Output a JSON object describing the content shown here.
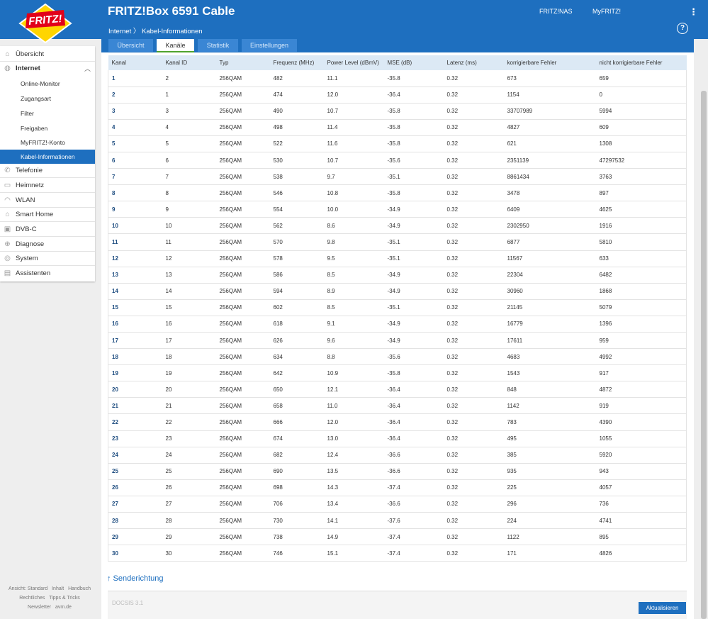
{
  "header": {
    "logo_text": "FRITZ!",
    "product": "FRITZ!Box 6591 Cable",
    "links": [
      "FRITZ!NAS",
      "MyFRITZ!"
    ],
    "menu_icon": "kebab-icon",
    "breadcrumb_parent": "Internet",
    "breadcrumb_sep": "〉",
    "breadcrumb_current": "Kabel-Informationen",
    "help": "?"
  },
  "tabs": [
    "Übersicht",
    "Kanäle",
    "Statistik",
    "Einstellungen"
  ],
  "sidebar": {
    "items": [
      {
        "label": "Übersicht",
        "icon": "home-icon"
      },
      {
        "label": "Internet",
        "icon": "globe-icon"
      },
      {
        "label": "Online-Monitor"
      },
      {
        "label": "Zugangsart"
      },
      {
        "label": "Filter"
      },
      {
        "label": "Freigaben"
      },
      {
        "label": "MyFRITZ!-Konto"
      },
      {
        "label": "Kabel-Informationen"
      },
      {
        "label": "Telefonie",
        "icon": "phone-icon"
      },
      {
        "label": "Heimnetz",
        "icon": "network-icon"
      },
      {
        "label": "WLAN",
        "icon": "wifi-icon"
      },
      {
        "label": "Smart Home",
        "icon": "smart-home-icon"
      },
      {
        "label": "DVB-C",
        "icon": "tv-icon"
      },
      {
        "label": "Diagnose",
        "icon": "diagnose-icon"
      },
      {
        "label": "System",
        "icon": "system-icon"
      },
      {
        "label": "Assistenten",
        "icon": "wizard-icon"
      }
    ],
    "chevron": "︿"
  },
  "footer": {
    "line1": [
      "Ansicht: Standard",
      "Inhalt",
      "Handbuch"
    ],
    "line2": [
      "Rechtliches",
      "Tipps & Tricks"
    ],
    "line3": [
      "Newsletter",
      "avm.de"
    ]
  },
  "table": {
    "headers": [
      "Kanal",
      "Kanal ID",
      "Typ",
      "Frequenz (MHz)",
      "Power Level (dBmV)",
      "MSE (dB)",
      "Latenz (ms)",
      "korrigierbare Fehler",
      "nicht korrigierbare Fehler"
    ],
    "rows": [
      [
        "1",
        "2",
        "256QAM",
        "482",
        "11.1",
        "-35.8",
        "0.32",
        "673",
        "659"
      ],
      [
        "2",
        "1",
        "256QAM",
        "474",
        "12.0",
        "-36.4",
        "0.32",
        "1154",
        "0"
      ],
      [
        "3",
        "3",
        "256QAM",
        "490",
        "10.7",
        "-35.8",
        "0.32",
        "33707989",
        "5994"
      ],
      [
        "4",
        "4",
        "256QAM",
        "498",
        "11.4",
        "-35.8",
        "0.32",
        "4827",
        "609"
      ],
      [
        "5",
        "5",
        "256QAM",
        "522",
        "11.6",
        "-35.8",
        "0.32",
        "621",
        "1308"
      ],
      [
        "6",
        "6",
        "256QAM",
        "530",
        "10.7",
        "-35.6",
        "0.32",
        "2351139",
        "47297532"
      ],
      [
        "7",
        "7",
        "256QAM",
        "538",
        "9.7",
        "-35.1",
        "0.32",
        "8861434",
        "3763"
      ],
      [
        "8",
        "8",
        "256QAM",
        "546",
        "10.8",
        "-35.8",
        "0.32",
        "3478",
        "897"
      ],
      [
        "9",
        "9",
        "256QAM",
        "554",
        "10.0",
        "-34.9",
        "0.32",
        "6409",
        "4625"
      ],
      [
        "10",
        "10",
        "256QAM",
        "562",
        "8.6",
        "-34.9",
        "0.32",
        "2302950",
        "1916"
      ],
      [
        "11",
        "11",
        "256QAM",
        "570",
        "9.8",
        "-35.1",
        "0.32",
        "6877",
        "5810"
      ],
      [
        "12",
        "12",
        "256QAM",
        "578",
        "9.5",
        "-35.1",
        "0.32",
        "11567",
        "633"
      ],
      [
        "13",
        "13",
        "256QAM",
        "586",
        "8.5",
        "-34.9",
        "0.32",
        "22304",
        "6482"
      ],
      [
        "14",
        "14",
        "256QAM",
        "594",
        "8.9",
        "-34.9",
        "0.32",
        "30960",
        "1868"
      ],
      [
        "15",
        "15",
        "256QAM",
        "602",
        "8.5",
        "-35.1",
        "0.32",
        "21145",
        "5079"
      ],
      [
        "16",
        "16",
        "256QAM",
        "618",
        "9.1",
        "-34.9",
        "0.32",
        "16779",
        "1396"
      ],
      [
        "17",
        "17",
        "256QAM",
        "626",
        "9.6",
        "-34.9",
        "0.32",
        "17611",
        "959"
      ],
      [
        "18",
        "18",
        "256QAM",
        "634",
        "8.8",
        "-35.6",
        "0.32",
        "4683",
        "4992"
      ],
      [
        "19",
        "19",
        "256QAM",
        "642",
        "10.9",
        "-35.8",
        "0.32",
        "1543",
        "917"
      ],
      [
        "20",
        "20",
        "256QAM",
        "650",
        "12.1",
        "-36.4",
        "0.32",
        "848",
        "4872"
      ],
      [
        "21",
        "21",
        "256QAM",
        "658",
        "11.0",
        "-36.4",
        "0.32",
        "1142",
        "919"
      ],
      [
        "22",
        "22",
        "256QAM",
        "666",
        "12.0",
        "-36.4",
        "0.32",
        "783",
        "4390"
      ],
      [
        "23",
        "23",
        "256QAM",
        "674",
        "13.0",
        "-36.4",
        "0.32",
        "495",
        "1055"
      ],
      [
        "24",
        "24",
        "256QAM",
        "682",
        "12.4",
        "-36.6",
        "0.32",
        "385",
        "5920"
      ],
      [
        "25",
        "25",
        "256QAM",
        "690",
        "13.5",
        "-36.6",
        "0.32",
        "935",
        "943"
      ],
      [
        "26",
        "26",
        "256QAM",
        "698",
        "14.3",
        "-37.4",
        "0.32",
        "225",
        "4057"
      ],
      [
        "27",
        "27",
        "256QAM",
        "706",
        "13.4",
        "-36.6",
        "0.32",
        "296",
        "736"
      ],
      [
        "28",
        "28",
        "256QAM",
        "730",
        "14.1",
        "-37.6",
        "0.32",
        "224",
        "4741"
      ],
      [
        "29",
        "29",
        "256QAM",
        "738",
        "14.9",
        "-37.4",
        "0.32",
        "1122",
        "895"
      ],
      [
        "30",
        "30",
        "256QAM",
        "746",
        "15.1",
        "-37.4",
        "0.32",
        "171",
        "4826"
      ]
    ]
  },
  "send_link": "↑ Senderichtung",
  "docsis_label": "DOCSIS 3.1",
  "refresh_button": "Aktualisieren",
  "colors": {
    "primary": "#1e6fbf",
    "tab_inactive": "#3a86d4",
    "active_underline": "#4fa32e",
    "header_row": "#dce9f5",
    "logo_yellow": "#ffd500",
    "logo_red": "#e2001a"
  }
}
